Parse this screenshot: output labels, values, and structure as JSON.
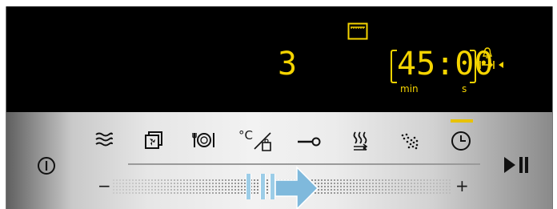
{
  "display": {
    "level": "3",
    "time": "45:00",
    "unit_min": "min",
    "unit_s": "s"
  },
  "panel": {
    "minus_label": "−",
    "plus_label": "+",
    "temp_label": "°C"
  },
  "icons": [
    "oven-icon",
    "bell-icon",
    "timer-end-icon",
    "power-icon",
    "heating-mode-icon",
    "hot-air-icon",
    "dish-icon",
    "temperature-weight-icon",
    "key-lock-icon",
    "rapid-heat-icon",
    "cleaning-icon",
    "clock-icon",
    "start-pause-icon",
    "swipe-arrow-icon"
  ],
  "colors": {
    "display_bg": "#000000",
    "segment": "#f5d400",
    "active_indicator": "#e8c200",
    "swipe_arrow": "#7fb9dc"
  }
}
